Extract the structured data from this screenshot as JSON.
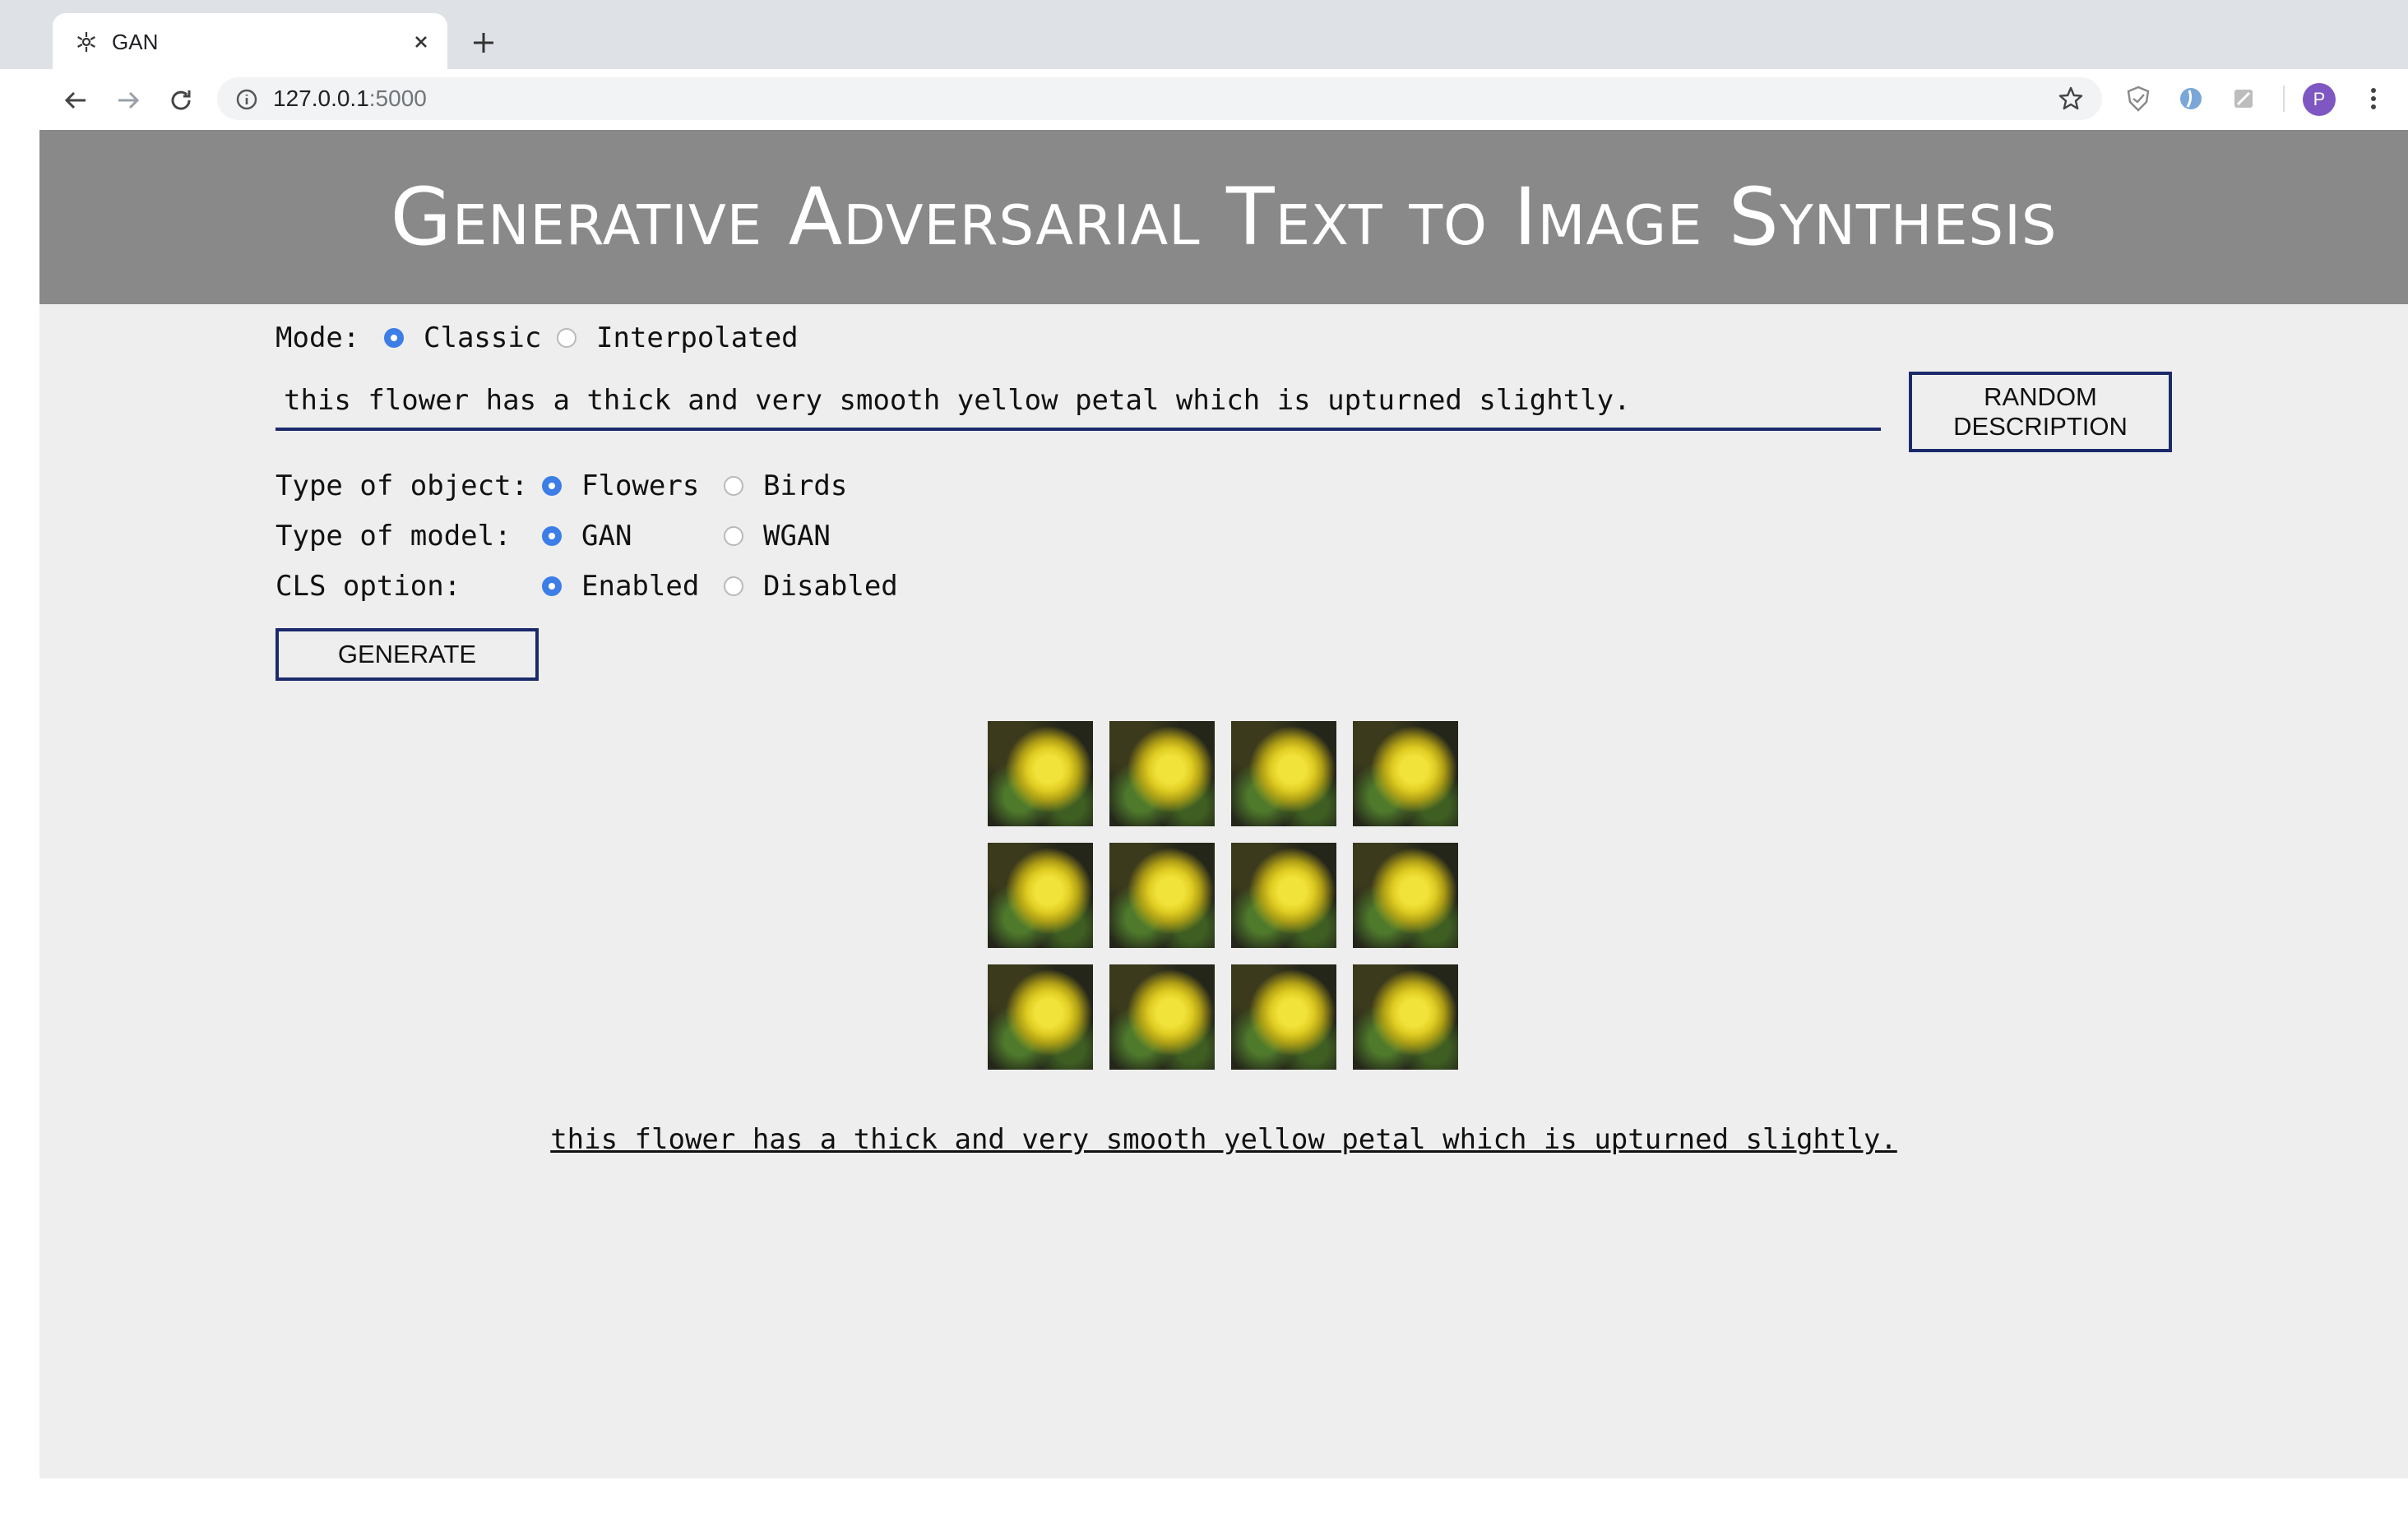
{
  "browser": {
    "tab_title": "GAN",
    "url_host": "127.0.0.1",
    "url_port": ":5000",
    "profile_initial": "P"
  },
  "page": {
    "title": "Generative Adversarial Text to Image Synthesis",
    "mode": {
      "label": "Mode:",
      "options": [
        "Classic",
        "Interpolated"
      ],
      "selected": "Classic"
    },
    "description_value": "this flower has a thick and very smooth yellow petal which is upturned slightly.",
    "random_button": "RANDOM DESCRIPTION",
    "object_type": {
      "label": "Type of object:",
      "options": [
        "Flowers",
        "Birds"
      ],
      "selected": "Flowers"
    },
    "model_type": {
      "label": "Type of model:",
      "options": [
        "GAN",
        "WGAN"
      ],
      "selected": "GAN"
    },
    "cls_option": {
      "label": "CLS option:",
      "options": [
        "Enabled",
        "Disabled"
      ],
      "selected": "Enabled"
    },
    "generate_button": "GENERATE",
    "images": [
      "generated-flower",
      "generated-flower",
      "generated-flower",
      "generated-flower",
      "generated-flower",
      "generated-flower",
      "generated-flower",
      "generated-flower",
      "generated-flower",
      "generated-flower",
      "generated-flower",
      "generated-flower"
    ],
    "caption": "this flower has a thick and very smooth yellow petal which is upturned slightly."
  },
  "colors": {
    "banner_bg": "#898989",
    "page_bg": "#eeeeee",
    "accent_border": "#1a2a6b",
    "radio_selected": "#3d7de6"
  }
}
